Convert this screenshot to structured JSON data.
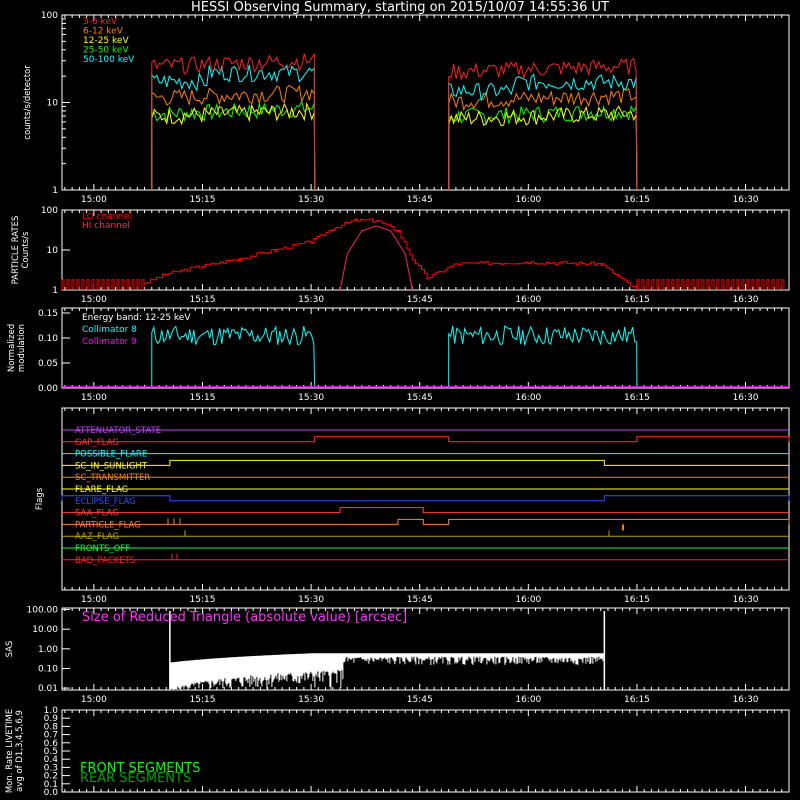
{
  "title": "HESSI Observing Summary, starting on 2015/10/07 14:55:36 UT",
  "colors": {
    "c3_6": "#ff2020",
    "c6_12": "#ff7f00",
    "c12_25": "#ffff00",
    "c25_50": "#00ff00",
    "c50_100": "#00ffff",
    "lo": "#ff0000",
    "hi": "#ff2060",
    "coll8": "#00ffff",
    "coll9": "#ff00ff",
    "front": "#00ff00",
    "rear": "#00a000"
  },
  "time_ticks": [
    "15:00",
    "15:15",
    "15:30",
    "15:45",
    "16:00",
    "16:15",
    "16:30"
  ],
  "chart_data": [
    {
      "type": "line",
      "id": "counts",
      "ylabel": "counts/s/detector",
      "yscale": "log",
      "ylim": [
        1,
        100
      ],
      "ytick_labels": [
        "1",
        "10",
        "100"
      ],
      "xlim": [
        "14:55:36",
        "16:36:00"
      ],
      "intervals": [
        [
          "15:08:00",
          "15:30:30"
        ],
        [
          "15:49:00",
          "16:15:00"
        ]
      ],
      "series": [
        {
          "name": "3-6 keV",
          "color_key": "c3_6",
          "values": [
            30,
            26
          ]
        },
        {
          "name": "6-12 keV",
          "color_key": "c6_12",
          "values": [
            13,
            12
          ]
        },
        {
          "name": "12-25 keV",
          "color_key": "c12_25",
          "values": [
            8,
            7.5
          ]
        },
        {
          "name": "25-50 keV",
          "color_key": "c25_50",
          "values": [
            8.5,
            8
          ]
        },
        {
          "name": "50-100 keV",
          "color_key": "c50_100",
          "values": [
            18,
            14
          ]
        }
      ]
    },
    {
      "type": "line",
      "id": "particle",
      "ylabel": "PARTICLE RATES Counts/s",
      "yscale": "log",
      "ylim": [
        1,
        100
      ],
      "ytick_labels": [
        "1",
        "10",
        "100"
      ],
      "series": [
        {
          "name": "LO channel",
          "color_key": "lo",
          "x": [
            "15:07",
            "15:10",
            "15:15",
            "15:20",
            "15:25",
            "15:30",
            "15:33",
            "15:36",
            "15:39",
            "15:42",
            "15:44",
            "15:46",
            "15:50",
            "16:00",
            "16:10",
            "16:15"
          ],
          "values": [
            1.5,
            2.5,
            4,
            6,
            10,
            16,
            35,
            55,
            55,
            30,
            6,
            2,
            4.5,
            5,
            4.5,
            1
          ]
        },
        {
          "name": "HI channel",
          "color_key": "hi",
          "x": [
            "15:34",
            "15:35",
            "15:37",
            "15:39",
            "15:41",
            "15:43",
            "15:44"
          ],
          "values": [
            1,
            8,
            30,
            40,
            30,
            8,
            1
          ]
        }
      ]
    },
    {
      "type": "line",
      "id": "modulation",
      "ylabel": "Normalized modulation",
      "ylim": [
        0,
        0.15
      ],
      "ytick_labels": [
        "0.00",
        "0.05",
        "0.10",
        "0.15"
      ],
      "annotation": "Energy band: 12-25 keV",
      "series": [
        {
          "name": "Collimator 8",
          "color_key": "coll8",
          "values": [
            0.105,
            0.105
          ]
        },
        {
          "name": "Collimator 9",
          "color_key": "coll9",
          "values": [
            0,
            0
          ]
        }
      ]
    },
    {
      "type": "line",
      "id": "flags",
      "ylabel": "Flags",
      "series": [
        {
          "name": "ATTENUATOR_STATE",
          "color": "#c040ff"
        },
        {
          "name": "GAP_FLAG",
          "color": "#ff3030"
        },
        {
          "name": "POSSIBLE_FLARE",
          "color": "#00ffff"
        },
        {
          "name": "SC_IN_SUNLIGHT",
          "color": "#ffff00"
        },
        {
          "name": "SC_TRANSMITTER",
          "color": "#ff8000"
        },
        {
          "name": "FLARE_FLAG",
          "color": "#ffff40"
        },
        {
          "name": "ECLIPSE_FLAG",
          "color": "#3050ff"
        },
        {
          "name": "SAA_FLAG",
          "color": "#ff4040"
        },
        {
          "name": "PARTICLE_FLAG",
          "color": "#ff8040"
        },
        {
          "name": "AAZ_FLAG",
          "color": "#c0a000"
        },
        {
          "name": "FRONTS_OFF",
          "color": "#00ff40"
        },
        {
          "name": "BAD_PACKETS",
          "color": "#ff2020"
        }
      ]
    },
    {
      "type": "line",
      "id": "sas",
      "ylabel": "SAS",
      "yscale": "log",
      "ylim": [
        0.01,
        100
      ],
      "ytick_labels": [
        "0.01",
        "0.10",
        "1.00",
        "10.00",
        "100.00"
      ],
      "annotation": "Size of Reduced Triangle (absolute value) [arcsec]",
      "series": [
        {
          "name": "",
          "color": "#ffffff",
          "values": [
            0.5
          ]
        }
      ]
    },
    {
      "type": "line",
      "id": "livetime",
      "ylabel": "Mon. Rate LIVETIME avg of D1,3,4,5,6,9",
      "ylim": [
        0,
        1
      ],
      "ytick_labels": [
        "0.0",
        "0.1",
        "0.2",
        "0.3",
        "0.4",
        "0.5",
        "0.6",
        "0.7",
        "0.8",
        "0.9",
        "1.0"
      ],
      "series": [
        {
          "name": "FRONT SEGMENTS",
          "color_key": "front"
        },
        {
          "name": "REAR SEGMENTS",
          "color_key": "rear"
        }
      ]
    }
  ]
}
